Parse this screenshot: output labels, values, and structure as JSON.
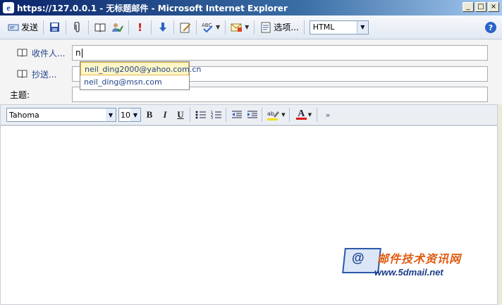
{
  "window": {
    "title": "https://127.0.0.1 - 无标题邮件 - Microsoft Internet Explorer",
    "minimize": "_",
    "maximize": "□",
    "close": "×"
  },
  "toolbar": {
    "send_label": "发送",
    "options_label": "选项...",
    "format_value": "HTML",
    "help": "?"
  },
  "headers": {
    "to_label": "收件人...",
    "to_value": "n",
    "cc_label": "抄送...",
    "cc_value": "",
    "subject_label": "主题:",
    "subject_value": ""
  },
  "autocomplete": {
    "items": [
      "neil_ding2000@yahoo.com.cn",
      "neil_ding@msn.com"
    ]
  },
  "formatting": {
    "font": "Tahoma",
    "size": "10",
    "bold": "B",
    "italic": "I",
    "underline": "U",
    "font_color_glyph": "A"
  },
  "watermark": {
    "text": "邮件技术资讯网",
    "url": "www.5dmail.net"
  },
  "colors": {
    "titlebar": "#0a246a",
    "accent": "#224488",
    "watermark_orange": "#e05a10"
  }
}
